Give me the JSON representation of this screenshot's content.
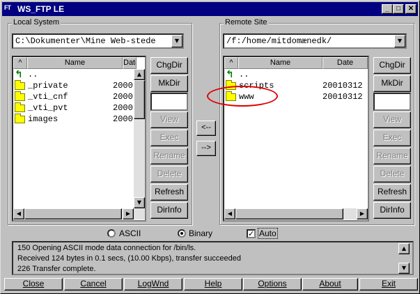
{
  "window": {
    "title": "WS_FTP LE",
    "icon_text": "FT",
    "buttons": [
      "_",
      "□",
      "✕"
    ]
  },
  "local": {
    "label": "Local System",
    "path": "C:\\Dokumenter\\Mine Web-stede",
    "columns": {
      "sort": "^",
      "name": "Name",
      "date": "Date"
    },
    "up_item": "..",
    "files": [
      {
        "name": "_private",
        "date": "2000"
      },
      {
        "name": "_vti_cnf",
        "date": "2000"
      },
      {
        "name": "_vti_pvt",
        "date": "2000"
      },
      {
        "name": "images",
        "date": "2000"
      }
    ],
    "buttons": {
      "chgdir": "ChgDir",
      "mkdir": "MkDir",
      "view": "View",
      "exec": "Exec",
      "rename": "Rename",
      "delete": "Delete",
      "refresh": "Refresh",
      "dirinfo": "DirInfo"
    }
  },
  "remote": {
    "label": "Remote Site",
    "path": "/f:/home/mitdomænedk/",
    "columns": {
      "sort": "^",
      "name": "Name",
      "date": "Date"
    },
    "up_item": "..",
    "files": [
      {
        "name": "scripts",
        "date": "20010312"
      },
      {
        "name": "www",
        "date": "20010312"
      }
    ],
    "buttons": {
      "chgdir": "ChgDir",
      "mkdir": "MkDir",
      "view": "View",
      "exec": "Exec",
      "rename": "Rename",
      "delete": "Delete",
      "refresh": "Refresh",
      "dirinfo": "DirInfo"
    }
  },
  "transfer": {
    "download": "<--",
    "upload": "-->"
  },
  "mode": {
    "ascii": "ASCII",
    "binary": "Binary",
    "auto": "Auto",
    "selected": "Binary",
    "auto_checked": true
  },
  "log": [
    "150 Opening ASCII mode data connection for /bin/ls.",
    "Received 124 bytes in 0.1 secs, (10.00 Kbps), transfer succeeded",
    "226 Transfer complete."
  ],
  "bottom_buttons": {
    "close": "Close",
    "cancel": "Cancel",
    "logwnd": "LogWnd",
    "help": "Help",
    "options": "Options",
    "about": "About",
    "exit": "Exit"
  },
  "highlight_color": "#e00000"
}
